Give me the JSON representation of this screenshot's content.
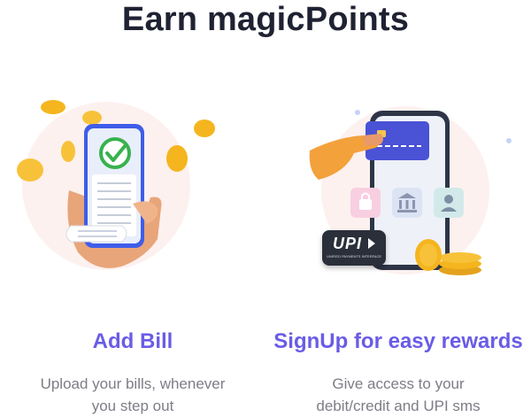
{
  "page": {
    "title": "Earn magicPoints"
  },
  "cards": [
    {
      "title": "Add Bill",
      "description_lines": [
        "Upload your bills, whenever",
        "you step out"
      ]
    },
    {
      "title": "SignUp for easy rewards",
      "description_lines": [
        "Give access to your",
        "debit/credit and UPI sms"
      ],
      "upi_badge": {
        "logo_text": "UPI",
        "sub_text": "UNIFIED PAYMENTS INTERFACE"
      }
    }
  ],
  "colors": {
    "title": "#1f2233",
    "accent": "#6a5ce6",
    "description": "#7d7d86",
    "coin": "#f5b51e",
    "check_green": "#37b24d",
    "phone_blue": "#3f5de8"
  }
}
